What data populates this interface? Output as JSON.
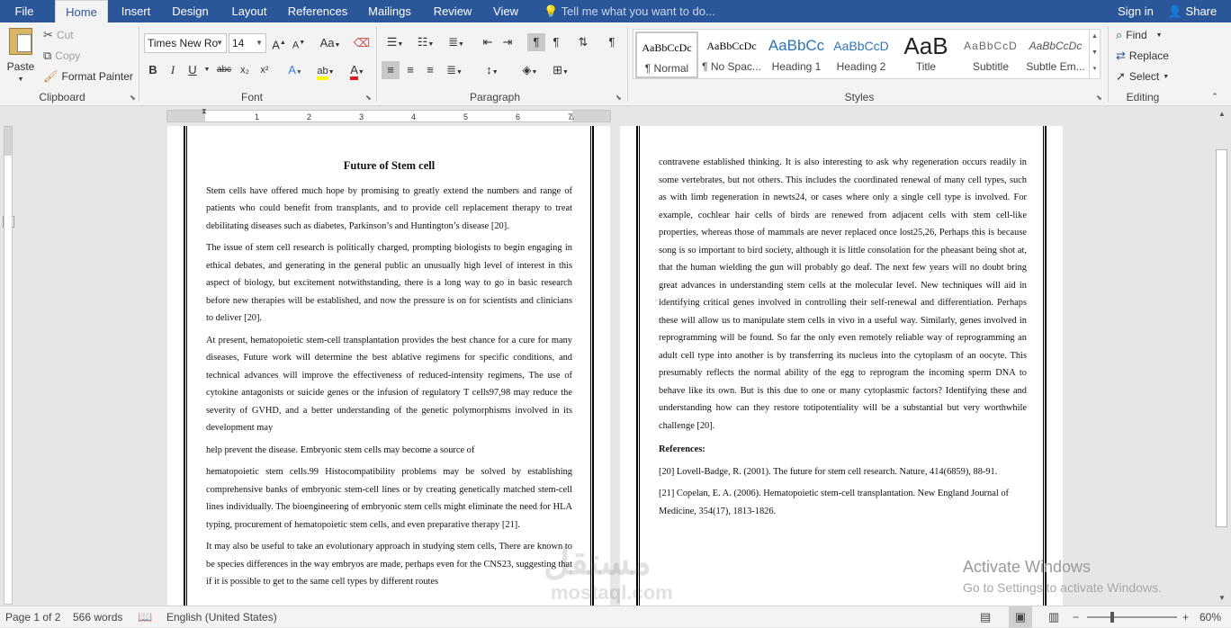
{
  "menu": {
    "tabs": [
      "File",
      "Home",
      "Insert",
      "Design",
      "Layout",
      "References",
      "Mailings",
      "Review",
      "View"
    ],
    "tell_me": "Tell me what you want to do...",
    "sign_in": "Sign in",
    "share": "Share"
  },
  "clipboard": {
    "paste": "Paste",
    "cut": "Cut",
    "copy": "Copy",
    "format_painter": "Format Painter",
    "label": "Clipboard"
  },
  "font": {
    "name": "Times New Ro",
    "size": "14",
    "label": "Font",
    "grow": "A",
    "shrink": "A",
    "change_case": "Aa",
    "bold": "B",
    "italic": "I",
    "underline": "U",
    "strike": "abc",
    "subscript": "x₂",
    "superscript": "x²",
    "effects": "A",
    "highlight": "ab",
    "color": "A"
  },
  "paragraph": {
    "label": "Paragraph"
  },
  "styles": {
    "label": "Styles",
    "items": [
      {
        "preview": "AaBbCcDc",
        "name": "¶ Normal"
      },
      {
        "preview": "AaBbCcDc",
        "name": "¶ No Spac..."
      },
      {
        "preview": "AaBbCc",
        "name": "Heading 1"
      },
      {
        "preview": "AaBbCcD",
        "name": "Heading 2"
      },
      {
        "preview": "AaB",
        "name": "Title"
      },
      {
        "preview": "AaBbCcD",
        "name": "Subtitle"
      },
      {
        "preview": "AaBbCcDc",
        "name": "Subtle Em..."
      }
    ]
  },
  "editing": {
    "label": "Editing",
    "find": "Find",
    "replace": "Replace",
    "select": "Select"
  },
  "ruler": {
    "marks": [
      "1",
      "2",
      "3",
      "4",
      "5",
      "6",
      "7"
    ]
  },
  "page1": {
    "title": "Future of Stem cell",
    "paragraphs": [
      "Stem cells have offered much hope by promising to greatly extend the numbers and range of patients who could benefit from transplants, and to provide cell replacement therapy to treat debilitating diseases such as diabetes, Parkinson’s and Huntington’s disease [20].",
      "The issue of stem cell research is politically charged, prompting biologists to begin engaging in ethical debates, and generating in the general public an unusually high level of interest in this aspect of biology, but excitement notwithstanding, there is a long way to go in basic research before new therapies will be established, and now the pressure is on for scientists and clinicians to deliver [20].",
      "At present, hematopoietic stem-cell transplantation provides the best chance for a cure for many diseases, Future work will determine the best ablative regimens for specific conditions, and technical advances will improve the effectiveness of reduced-intensity regimens, The use of cytokine antagonists or suicide genes or the infusion of regulatory T cells97,98 may reduce the severity of GVHD, and a better understanding of the genetic polymorphisms involved in its development may",
      "help prevent the disease. Embryonic stem cells may become a source of",
      "hematopoietic stem cells.99 Histocompatibility problems may be solved by establishing comprehensive banks of embryonic stem-cell lines or by creating genetically matched stem-cell lines individually. The bioengineering of embryonic stem cells might eliminate the need for HLA typing, procurement of hematopoietic stem cells, and even preparative therapy [21].",
      "It may also be useful to take an evolutionary approach in studying stem cells, There are known to be species differences in the way embryos are made, perhaps even for the CNS23, suggesting that if it is possible to get to the same cell types by different routes"
    ]
  },
  "page2": {
    "paragraphs": [
      "contravene established thinking. It is also interesting to ask why regeneration occurs readily in some vertebrates, but not others. This includes the coordinated renewal of many cell types, such as with limb regeneration in newts24, or cases where only a single cell type is involved. For example, cochlear hair cells of birds are renewed from adjacent cells with stem cell-like properties, whereas those of mammals are never replaced once lost25,26, Perhaps this is because song is so important to bird society, although it is little consolation for the pheasant being shot at, that the human wielding the gun will probably go deaf. The next few years will no doubt bring great advances in understanding stem cells at the molecular level. New techniques will aid in identifying critical genes involved in controlling their self-renewal and differentiation. Perhaps these will allow us to manipulate stem cells in vivo in a useful way. Similarly, genes involved in reprogramming will be found. So far the only even remotely reliable way of reprogramming an adult cell type into another is by transferring its nucleus into the cytoplasm of an oocyte. This presumably reflects the normal ability of the egg to reprogram the incoming sperm DNA to behave like its own. But is this due to one or many cytoplasmic factors? Identifying these and understanding how can they restore totipotentiality will be a substantial but very worthwhile challenge [20]."
    ],
    "references_heading": "References:",
    "references": [
      "[20] Lovell-Badge, R. (2001). The future for stem cell research. Nature, 414(6859), 88-91.",
      "[21] Copelan, E. A. (2006). Hematopoietic stem-cell transplantation. New England Journal of Medicine, 354(17), 1813-1826."
    ]
  },
  "activation": {
    "title": "Activate Windows",
    "subtitle": "Go to Settings to activate Windows."
  },
  "watermark_text": "mostaql.com",
  "status": {
    "page": "Page 1 of 2",
    "words": "566 words",
    "language": "English (United States)",
    "zoom": "60%",
    "zoom_level": 0.6
  },
  "colors": {
    "ribbon_blue": "#2b579a",
    "ribbon_bg": "#f3f3f3",
    "highlight": "#ffff00",
    "font_color": "#e02020"
  }
}
